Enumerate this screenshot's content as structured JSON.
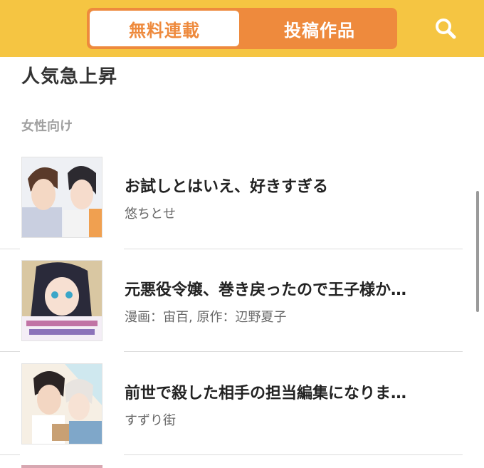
{
  "header": {
    "tabs": [
      {
        "label": "無料連載",
        "active": true
      },
      {
        "label": "投稿作品",
        "active": false
      }
    ],
    "search_icon": "search-icon"
  },
  "section": {
    "title": "人気急上昇",
    "subtitle": "女性向け"
  },
  "items": [
    {
      "title": "お試しとはいえ、好きすぎる",
      "author": "悠ちとせ"
    },
    {
      "title": "元悪役令嬢、巻き戻ったので王子様か…",
      "author": "漫画：宙百,  原作：辺野夏子"
    },
    {
      "title": "前世で殺した相手の担当編集になりま…",
      "author": "すずり街"
    }
  ],
  "colors": {
    "header_bg": "#f5c542",
    "accent": "#ee8a3d"
  }
}
